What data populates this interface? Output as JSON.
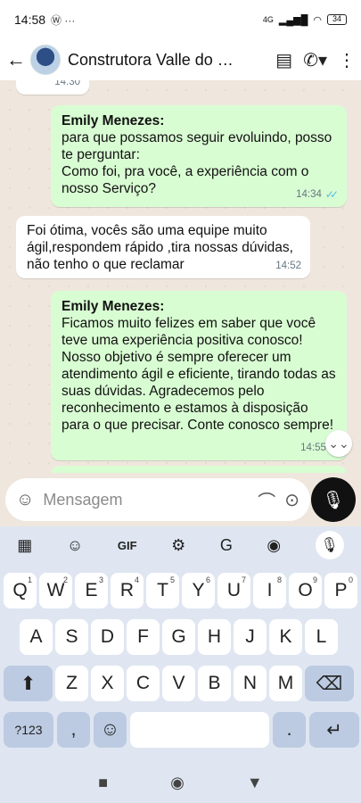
{
  "status": {
    "time": "14:58",
    "left_icons": "Ⓦ ···",
    "network": "4G",
    "battery": "34"
  },
  "header": {
    "title": "Construtora Valle do O..."
  },
  "chat": {
    "partial_time": "14:30",
    "messages": [
      {
        "sender": "Emily Menezes:",
        "text": "para que possamos seguir evoluindo, posso te perguntar:\nComo foi, pra você, a experiência com o nosso Serviço?",
        "time": "14:34"
      },
      {
        "text": "Foi ótima, vocês são uma equipe muito ágil,respondem rápido ,tira nossas dúvidas, não tenho o que reclamar",
        "time": "14:52"
      },
      {
        "sender": "Emily Menezes:",
        "text": "Ficamos muito felizes em saber que você teve uma experiência positiva conosco! Nosso objetivo é sempre oferecer um atendimento ágil e eficiente, tirando todas as suas dúvidas. Agradecemos pelo reconhecimento e estamos à disposição para o que precisar. Conte conosco sempre!",
        "time": "14:55"
      }
    ]
  },
  "input": {
    "placeholder": "Mensagem"
  },
  "keyboard": {
    "gif_label": "GIF",
    "row1": [
      "Q",
      "W",
      "E",
      "R",
      "T",
      "Y",
      "U",
      "I",
      "O",
      "P"
    ],
    "row1_hints": [
      "1",
      "2",
      "3",
      "4",
      "5",
      "6",
      "7",
      "8",
      "9",
      "0"
    ],
    "row2": [
      "A",
      "S",
      "D",
      "F",
      "G",
      "H",
      "J",
      "K",
      "L"
    ],
    "row3": [
      "Z",
      "X",
      "C",
      "V",
      "B",
      "N",
      "M"
    ],
    "symbols_label": "?123",
    "comma": ",",
    "period": "."
  },
  "colors": {
    "outgoing_bubble": "#d9fdd3",
    "chat_bg": "#efe7dd",
    "read_ticks": "#53bdeb",
    "keyboard_bg": "#dfe6f1"
  }
}
